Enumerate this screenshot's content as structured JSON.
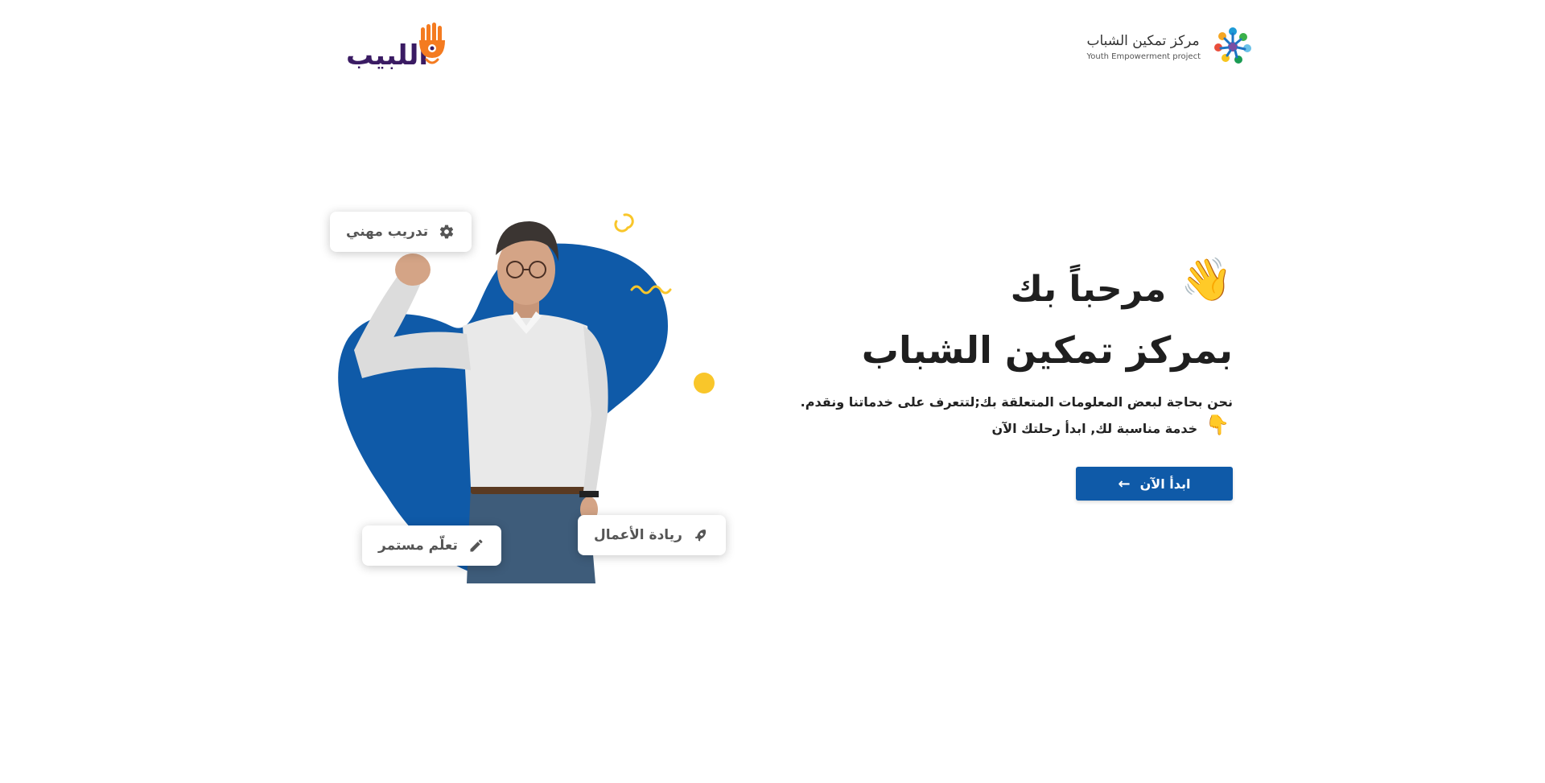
{
  "header": {
    "org_title": "مركز تمكين الشباب",
    "org_subtitle": "Youth Empowerment project",
    "partner_logo_text": "اللبيب",
    "org_logo_icon": "colorful-people-cluster-icon",
    "partner_logo_icon": "orange-hand-icon"
  },
  "hero": {
    "chips": [
      {
        "label": "تدريب مهني",
        "icon": "gear-icon"
      },
      {
        "label": "ريادة الأعمال",
        "icon": "rocket-icon"
      },
      {
        "label": "تعلّم مستمر",
        "icon": "pencil-icon"
      }
    ],
    "colors": {
      "blob": "#0f5aa8",
      "accent": "#f9c62a"
    }
  },
  "welcome": {
    "heading_line1": "مرحباً بك",
    "heading_line2": "بمركز تمكين الشباب",
    "wave_emoji": "👋",
    "description_line1": "نحن بحاجة لبعض المعلومات المتعلقة بك;لتتعرف على خدماتنا ونقدم.",
    "description_line2": "خدمة مناسبة لك, ابدأ رحلتك الآن",
    "pointing_emoji": "👇",
    "start_button_label": "ابدأ الآن",
    "start_button_icon": "arrow-left-icon",
    "button_color": "#0f5aa8"
  }
}
